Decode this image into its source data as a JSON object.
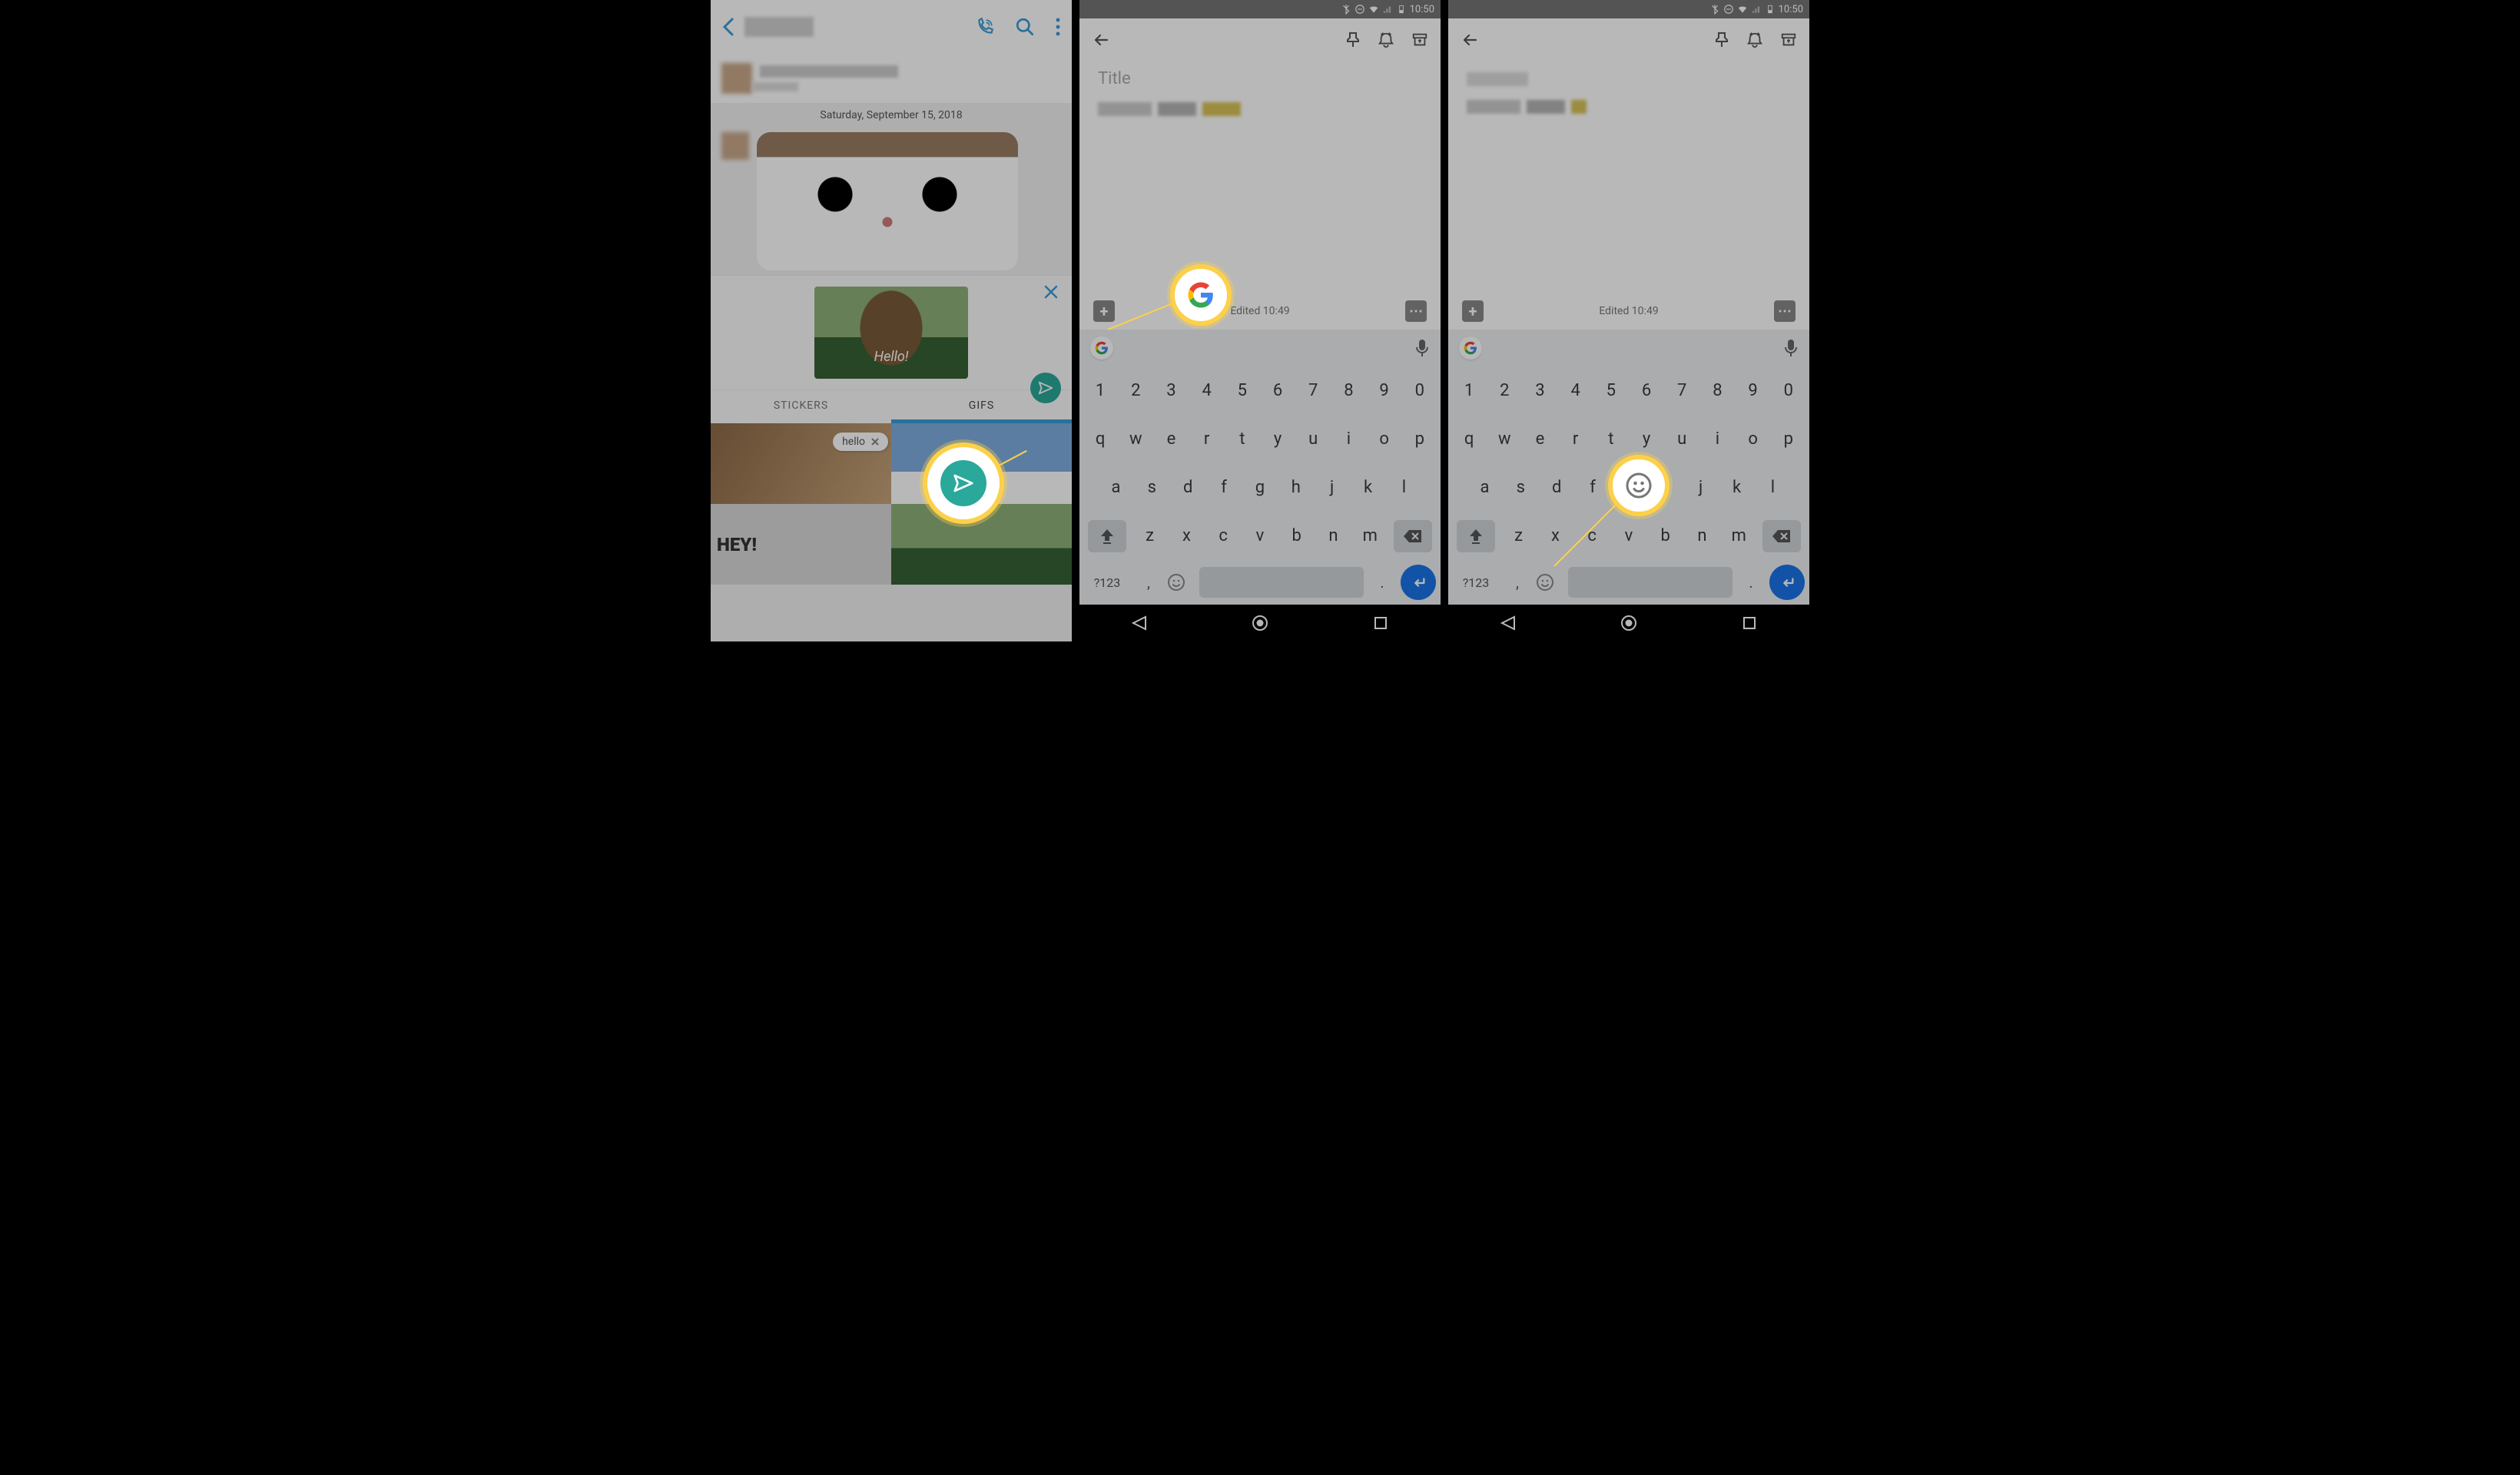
{
  "phone1": {
    "date_divider": "Saturday, September 15, 2018",
    "preview_caption": "Hello!",
    "hey_text": "HEY!",
    "tabs": {
      "stickers": "STICKERS",
      "gifs": "GIFS"
    },
    "search_term": "hello"
  },
  "phone2": {
    "status_time": "10:50",
    "title_placeholder": "Title",
    "edited_label": "Edited 10:49",
    "plus_label": "+",
    "menu_label": "⋯",
    "keyboard": {
      "row_num": [
        "1",
        "2",
        "3",
        "4",
        "5",
        "6",
        "7",
        "8",
        "9",
        "0"
      ],
      "row_top": [
        "q",
        "w",
        "e",
        "r",
        "t",
        "y",
        "u",
        "i",
        "o",
        "p"
      ],
      "row_mid": [
        "a",
        "s",
        "d",
        "f",
        "g",
        "h",
        "j",
        "k",
        "l"
      ],
      "row_bot": [
        "z",
        "x",
        "c",
        "v",
        "b",
        "n",
        "m"
      ],
      "sym_key": "?123",
      "comma": ",",
      "period": "."
    }
  },
  "phone3": {
    "status_time": "10:50",
    "edited_label": "Edited 10:49"
  }
}
